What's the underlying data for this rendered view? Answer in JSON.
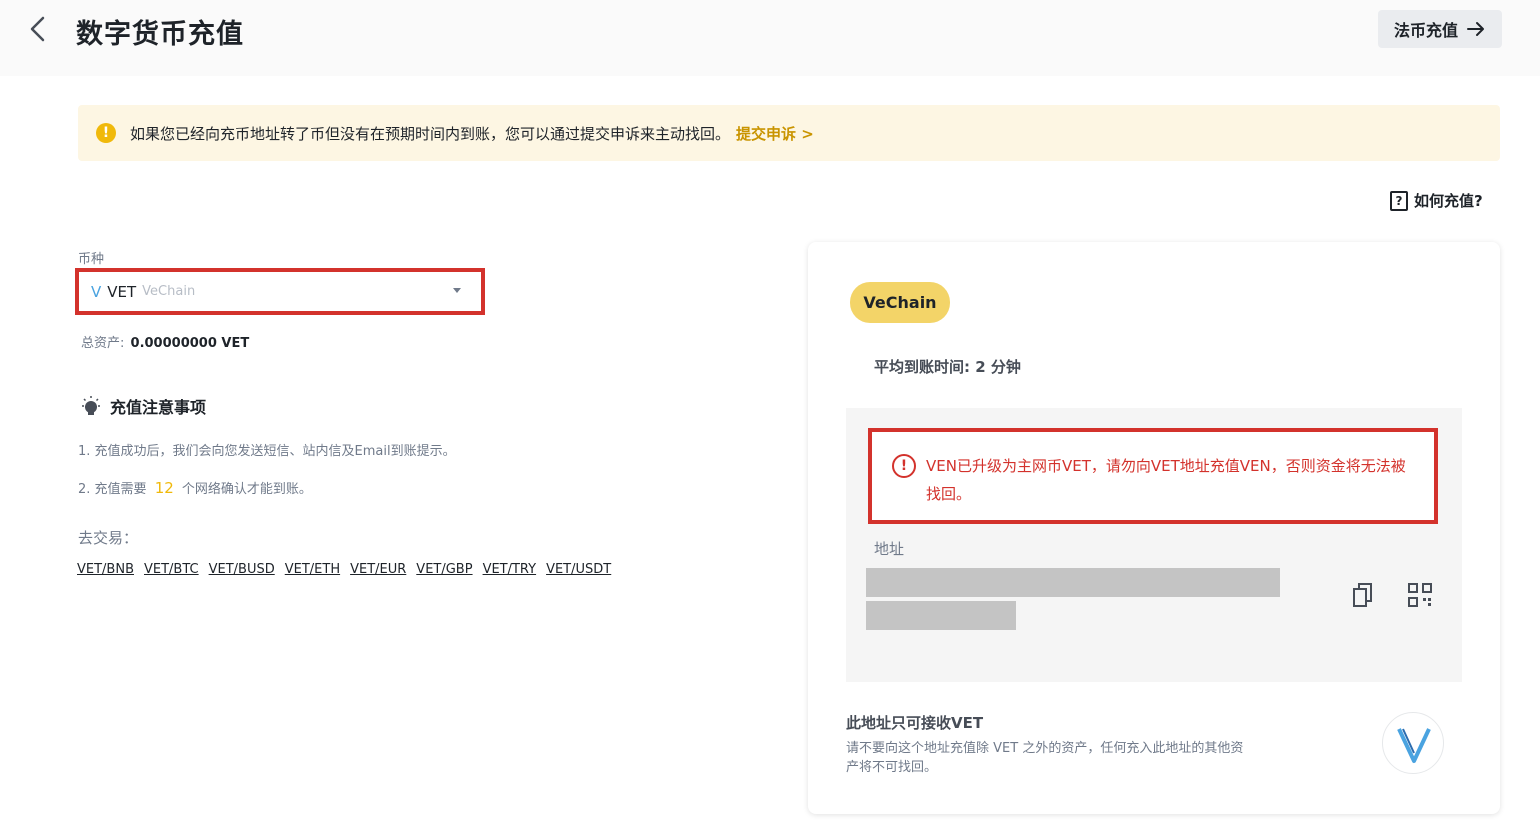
{
  "header": {
    "title": "数字货币充值",
    "fiat_button": "法币充值"
  },
  "notice": {
    "text": "如果您已经向充币地址转了币但没有在预期时间内到账，您可以通过提交申诉来主动找回。",
    "link": "提交申诉 >"
  },
  "howto": "如何充值?",
  "coin": {
    "label": "币种",
    "symbol": "VET",
    "name": "VeChain",
    "balance_label": "总资产:",
    "balance_value": "0.00000000 VET"
  },
  "notes": {
    "title": "充值注意事项",
    "item1": "1. 充值成功后，我们会向您发送短信、站内信及Email到账提示。",
    "item2_prefix": "2. 充值需要",
    "item2_number": "12",
    "item2_suffix": "个网络确认才能到账。"
  },
  "trade": {
    "label": "去交易：",
    "pairs": [
      "VET/BNB",
      "VET/BTC",
      "VET/BUSD",
      "VET/ETH",
      "VET/EUR",
      "VET/GBP",
      "VET/TRY",
      "VET/USDT"
    ]
  },
  "card": {
    "network": "VeChain",
    "avg_time_label": "平均到账时间:",
    "avg_time_value": "2 分钟",
    "warning": "VEN已升级为主网币VET，请勿向VET地址充值VEN，否则资金将无法被找回。",
    "address_label": "地址",
    "only_title": "此地址只可接收VET",
    "only_desc": "请不要向这个地址充值除 VET 之外的资产，任何充入此地址的其他资产将不可找回。"
  },
  "colors": {
    "accent": "#f0b90b",
    "link": "#c99400",
    "warning_red": "#d3322c",
    "pill": "#f3d468"
  },
  "icons": [
    "back-arrow-icon",
    "arrow-right-icon",
    "exclamation-icon",
    "question-icon",
    "bulb-icon",
    "copy-icon",
    "qr-code-icon",
    "vechain-logo-icon",
    "caret-down-icon"
  ]
}
